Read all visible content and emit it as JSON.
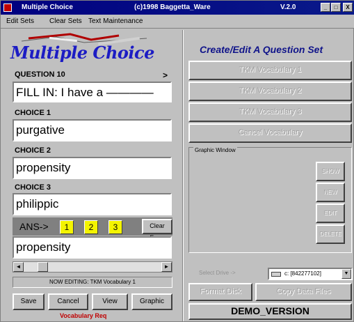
{
  "titlebar": {
    "app_name": "Multiple Choice",
    "copyright": "(c)1998  Baggetta_Ware",
    "version": "V.2.0",
    "min": "_",
    "max": "□",
    "close": "X"
  },
  "menu": {
    "items": [
      "Edit Sets",
      "Clear Sets",
      "Text Maintenance"
    ]
  },
  "logo_text": "Multiple Choice",
  "question": {
    "label": "QUESTION 10",
    "next": ">",
    "value": "FILL IN: I have a ————"
  },
  "choices": [
    {
      "label": "CHOICE 1",
      "value": "purgative"
    },
    {
      "label": "CHOICE 2",
      "value": "propensity"
    },
    {
      "label": "CHOICE 3",
      "value": "philippic"
    }
  ],
  "answer": {
    "label": "ANS->",
    "options": [
      "1",
      "2",
      "3"
    ],
    "clear_label": "Clear Form",
    "value": "propensity"
  },
  "scroll": {
    "left": "◄",
    "right": "►"
  },
  "status": "NOW EDITING: TKM Vocabulary 1",
  "bottom_buttons": [
    "Save",
    "Cancel",
    "View",
    "Graphic"
  ],
  "vocab_req": "Vocabulary Req",
  "right": {
    "title": "Create/Edit A Question Set",
    "vocab_buttons": [
      "TKM Vocabulary 1",
      "TKM Vocabulary 2",
      "TKM Vocabulary 3",
      "Cancel Vocabulary"
    ],
    "graphic_window_label": "Graphic Window",
    "graphic_buttons": [
      "SHOW",
      "NEW",
      "EDIT",
      "DELETE"
    ],
    "drive_label": "Select Drive ->",
    "drive_value": "c: [842277102]",
    "drive_drop": "▼",
    "format_label": "Format Disk",
    "copy_label": "Copy Data Files",
    "demo_label": "DEMO_VERSION"
  }
}
